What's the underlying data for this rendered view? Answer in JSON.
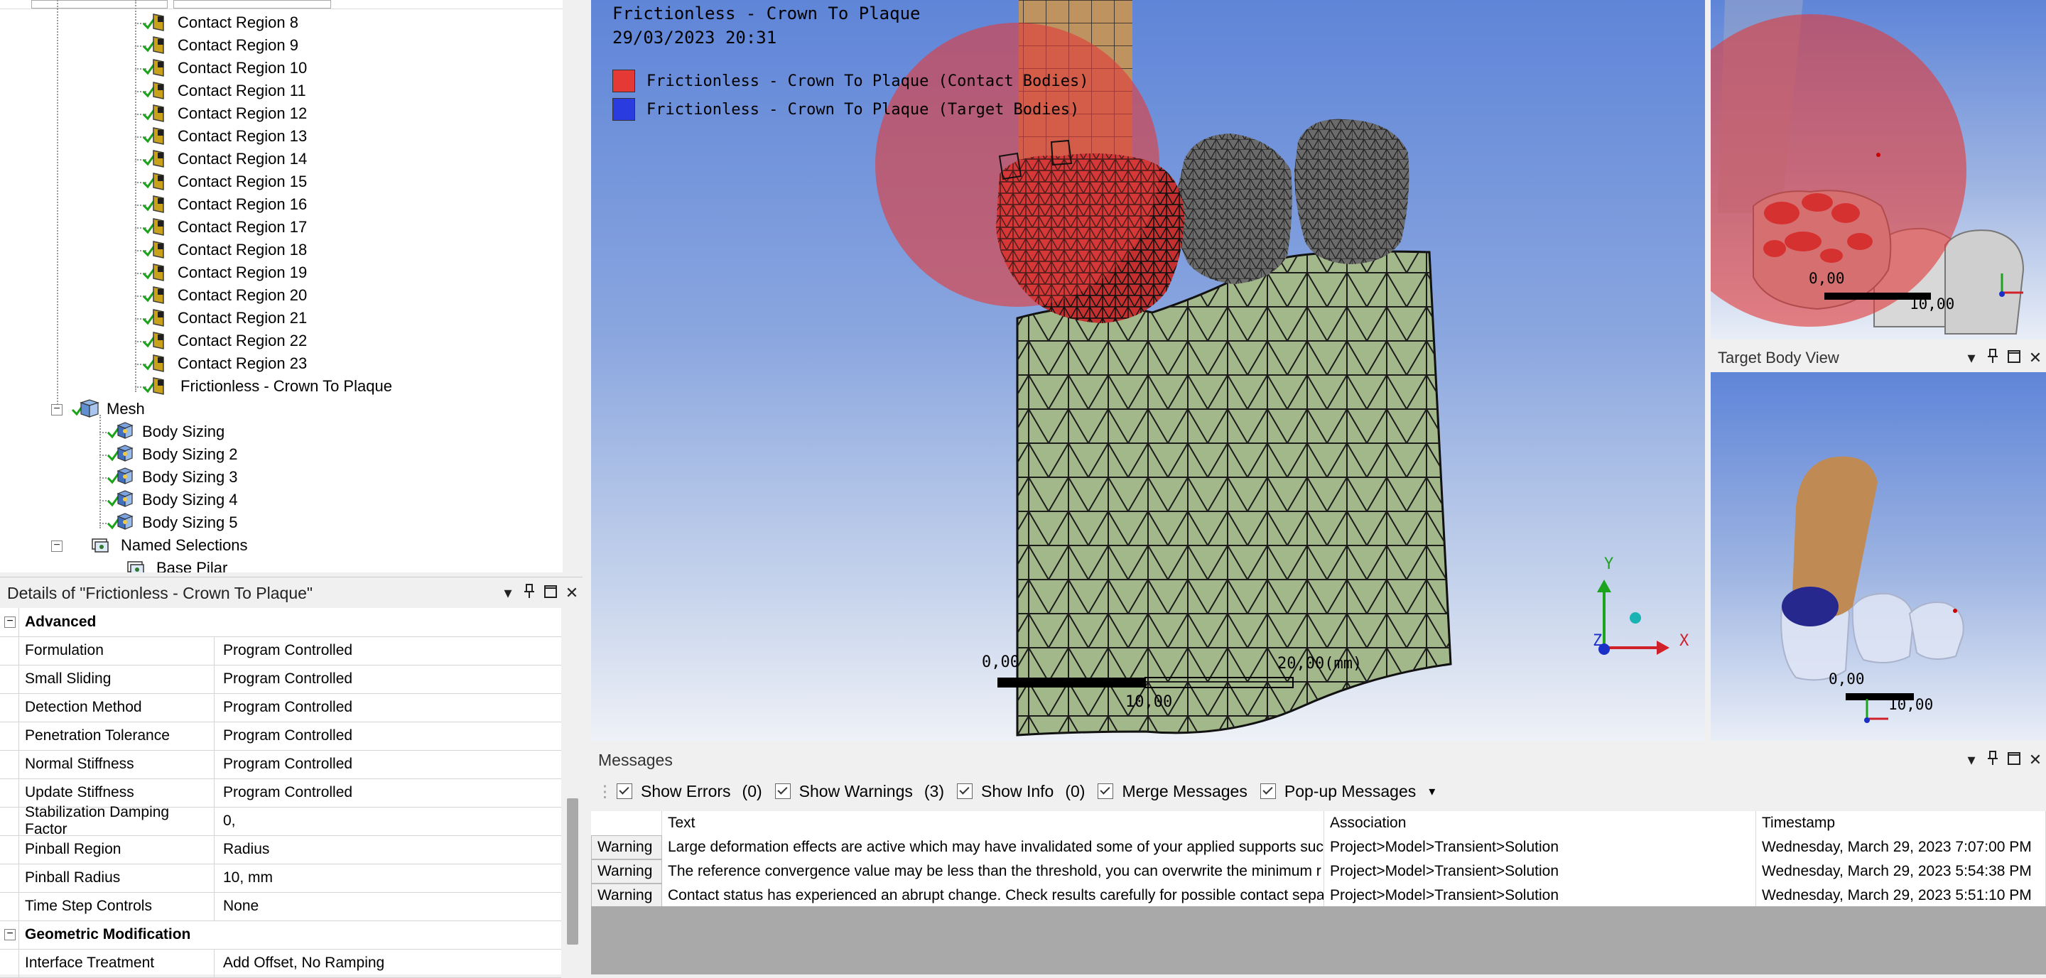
{
  "tree": {
    "contact_regions": [
      "Contact Region 8",
      "Contact Region 9",
      "Contact Region 10",
      "Contact Region 11",
      "Contact Region 12",
      "Contact Region 13",
      "Contact Region 14",
      "Contact Region 15",
      "Contact Region 16",
      "Contact Region 17",
      "Contact Region 18",
      "Contact Region 19",
      "Contact Region 20",
      "Contact Region 21",
      "Contact Region 22",
      "Contact Region 23"
    ],
    "selected_contact": "Frictionless - Crown To Plaque",
    "mesh_label": "Mesh",
    "mesh_items": [
      "Body Sizing",
      "Body Sizing 2",
      "Body Sizing 3",
      "Body Sizing 4",
      "Body Sizing 5"
    ],
    "named_selections_label": "Named Selections",
    "named_selection_first": "Base Pilar"
  },
  "details": {
    "title": "Details of \"Frictionless - Crown To Plaque\"",
    "section_advanced": "Advanced",
    "rows": [
      {
        "k": "Formulation",
        "v": "Program Controlled"
      },
      {
        "k": "Small Sliding",
        "v": "Program Controlled"
      },
      {
        "k": "Detection Method",
        "v": "Program Controlled"
      },
      {
        "k": "Penetration Tolerance",
        "v": "Program Controlled"
      },
      {
        "k": "Normal Stiffness",
        "v": "Program Controlled"
      },
      {
        "k": "Update Stiffness",
        "v": "Program Controlled"
      },
      {
        "k": "Stabilization Damping Factor",
        "v": "0,"
      },
      {
        "k": "Pinball Region",
        "v": "Radius"
      },
      {
        "k": "Pinball Radius",
        "v": "10, mm"
      },
      {
        "k": "Time Step Controls",
        "v": "None"
      }
    ],
    "section_geometric": "Geometric Modification",
    "geo_rows": [
      {
        "k": "Interface Treatment",
        "v": "Add Offset, No Ramping"
      }
    ]
  },
  "viewport": {
    "title": "Frictionless - Crown To Plaque",
    "date": "29/03/2023 20:31",
    "legend": [
      {
        "label": "Frictionless - Crown To Plaque (Contact Bodies)",
        "color": "#e53935"
      },
      {
        "label": "Frictionless - Crown To Plaque (Target Bodies)",
        "color": "#2a3be0"
      }
    ],
    "scale_left": "0,00",
    "scale_mid": "10,00",
    "scale_right": "20,00(mm)",
    "axis_x": "X",
    "axis_y": "Y",
    "axis_z": "Z"
  },
  "contact_view": {
    "scale_left": "0,00",
    "scale_right": "10,00"
  },
  "target_view": {
    "title": "Target Body View",
    "scale_left": "0,00",
    "scale_right": "10,00"
  },
  "messages": {
    "title": "Messages",
    "toolbar": [
      {
        "label": "Show Errors",
        "count": "(0)"
      },
      {
        "label": "Show Warnings",
        "count": "(3)"
      },
      {
        "label": "Show Info",
        "count": "(0)"
      },
      {
        "label": "Merge Messages",
        "count": ""
      },
      {
        "label": "Pop-up Messages",
        "count": ""
      }
    ],
    "columns": [
      "",
      "Text",
      "Association",
      "Timestamp"
    ],
    "rows": [
      {
        "severity": "Warning",
        "text": "Large deformation effects are active which may have invalidated some of your applied supports such",
        "assoc": "Project>Model>Transient>Solution",
        "time": "Wednesday, March 29, 2023 7:07:00 PM"
      },
      {
        "severity": "Warning",
        "text": "The reference convergence value may be less than the threshold, you can overwrite the minimum r",
        "assoc": "Project>Model>Transient>Solution",
        "time": "Wednesday, March 29, 2023 5:54:38 PM"
      },
      {
        "severity": "Warning",
        "text": "Contact status has experienced an abrupt change.  Check results carefully for possible contact separa",
        "assoc": "Project>Model>Transient>Solution",
        "time": "Wednesday, March 29, 2023 5:51:10 PM"
      }
    ]
  },
  "colors": {
    "tooth_body": "#c49a64",
    "pinball": "#d93a3a",
    "plaque": "#a9bd8f",
    "check": "#1aa31a"
  }
}
